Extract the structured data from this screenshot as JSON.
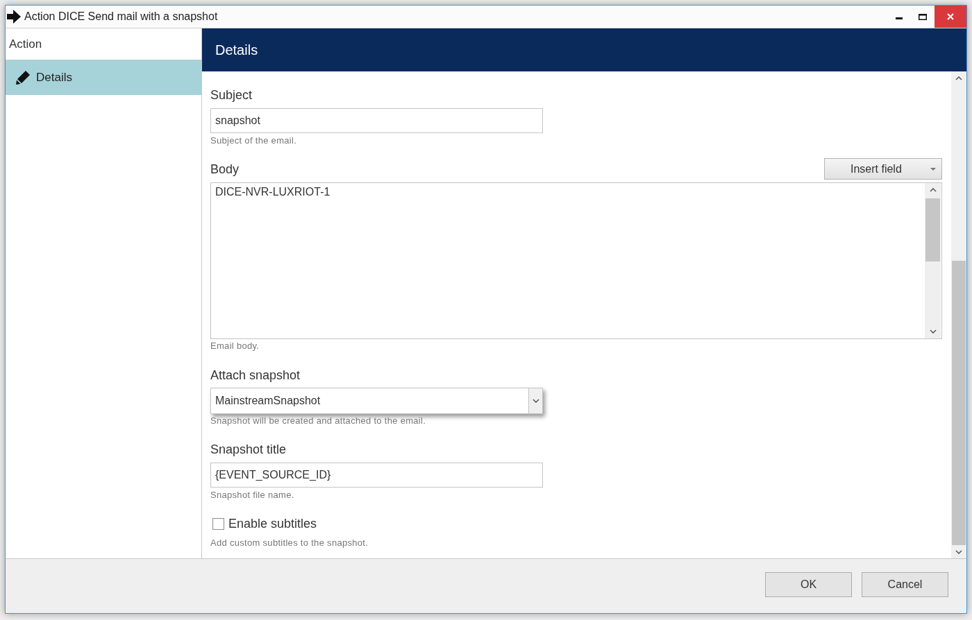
{
  "window": {
    "title": "Action DICE Send mail with a snapshot"
  },
  "sidebar": {
    "header": "Action",
    "items": [
      {
        "label": "Details",
        "selected": true
      }
    ]
  },
  "panel": {
    "title": "Details",
    "fields": [
      {
        "kind": "text",
        "label": "Subject",
        "value": "snapshot",
        "hint": "Subject of the email."
      },
      {
        "kind": "textarea",
        "label": "Body",
        "button": "Insert field",
        "value": "DICE-NVR-LUXRIOT-1",
        "hint": "Email body."
      },
      {
        "kind": "select",
        "label": "Attach snapshot",
        "value": "MainstreamSnapshot",
        "hint": "Snapshot will be created and attached to the email."
      },
      {
        "kind": "text",
        "label": "Snapshot title",
        "value": "{EVENT_SOURCE_ID}",
        "hint": "Snapshot file name."
      },
      {
        "kind": "checkbox",
        "label": "Enable subtitles",
        "checked": false,
        "hint": "Add custom subtitles to the snapshot."
      }
    ]
  },
  "buttons": [
    "OK",
    "Cancel"
  ]
}
